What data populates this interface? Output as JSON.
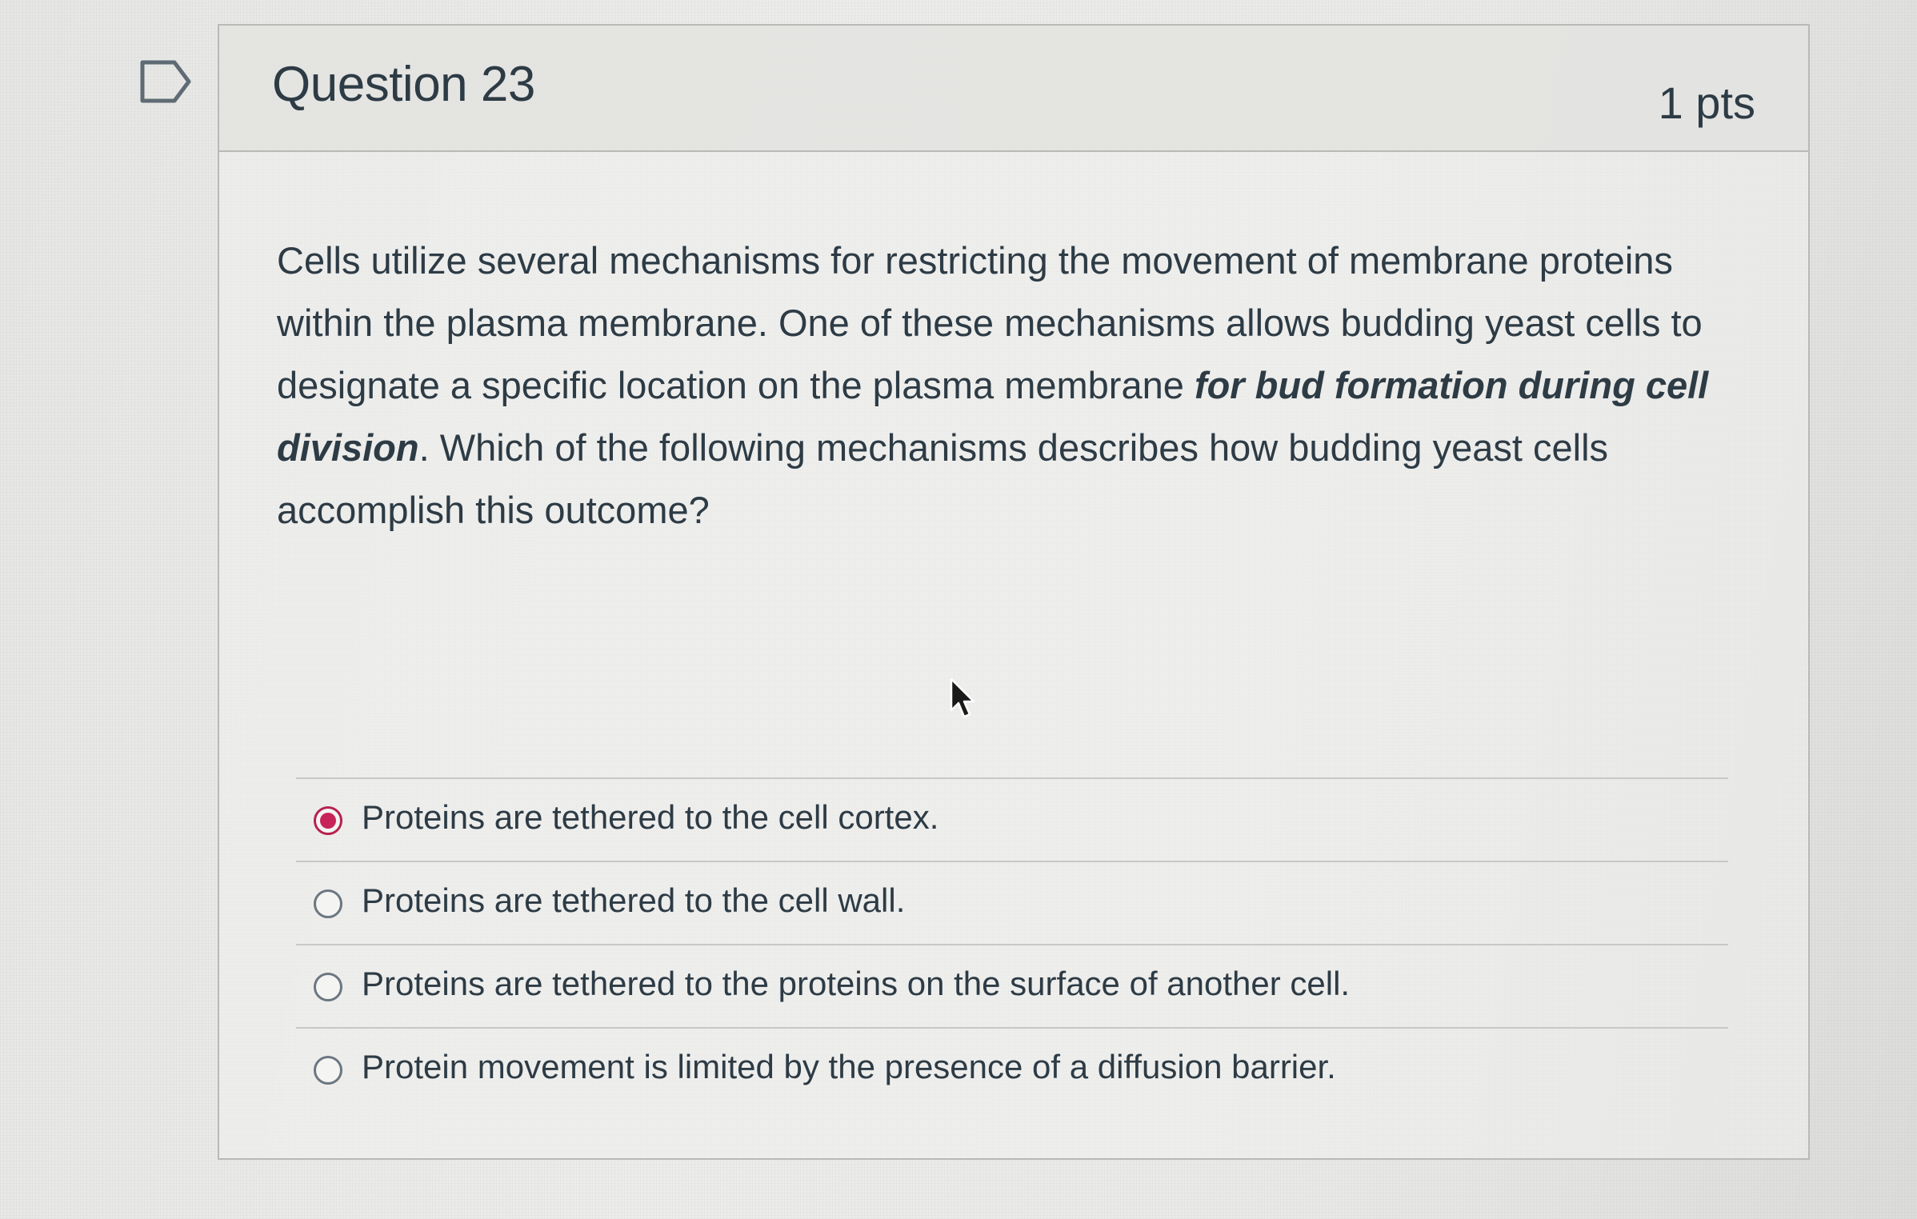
{
  "question": {
    "title": "Question 23",
    "points": "1 pts",
    "text_part1": "Cells utilize several mechanisms for restricting the movement of membrane proteins within the plasma membrane. One of these mechanisms allows budding yeast cells to designate a specific location on the plasma membrane ",
    "text_emphasis": "for bud formation during cell division",
    "text_part2": ". Which of the following mechanisms describes how budding yeast cells accomplish this outcome?"
  },
  "answers": [
    {
      "label": "Proteins are tethered to the cell cortex.",
      "selected": true
    },
    {
      "label": "Proteins are tethered to the cell wall.",
      "selected": false
    },
    {
      "label": "Proteins are tethered to the proteins on the surface of another cell.",
      "selected": false
    },
    {
      "label": "Protein movement is limited by the presence of a diffusion barrier.",
      "selected": false
    }
  ],
  "colors": {
    "selected_radio": "#c8245a",
    "text": "#2d3b45"
  },
  "icons": {
    "flag": "flag-question-icon",
    "cursor": "mouse-pointer-icon"
  }
}
